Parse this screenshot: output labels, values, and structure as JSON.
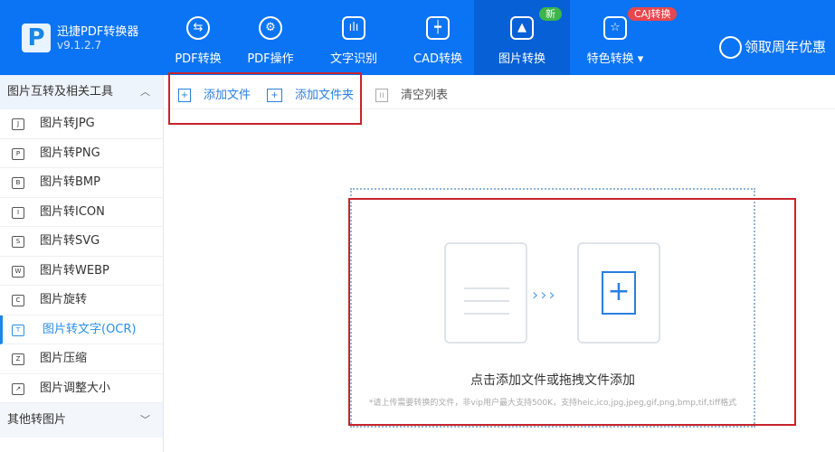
{
  "app": {
    "name": "迅捷PDF转换器",
    "version": "v9.1.2.7"
  },
  "nav": [
    {
      "label": "PDF转换",
      "icon": "⇆"
    },
    {
      "label": "PDF操作",
      "icon": "⚙"
    },
    {
      "label": "文字识别",
      "icon": "ılı"
    },
    {
      "label": "CAD转换",
      "icon": "┿"
    },
    {
      "label": "图片转换",
      "icon": "▲"
    },
    {
      "label": "特色转换 ▾",
      "icon": "☆"
    }
  ],
  "badges": {
    "new": "新",
    "caj": "CAJ转换"
  },
  "promo": "领取周年优惠",
  "sidebar": {
    "section1": "图片互转及相关工具",
    "section2": "其他转图片",
    "items": [
      {
        "label": "图片转JPG",
        "ic": "J"
      },
      {
        "label": "图片转PNG",
        "ic": "P"
      },
      {
        "label": "图片转BMP",
        "ic": "B"
      },
      {
        "label": "图片转ICON",
        "ic": "I"
      },
      {
        "label": "图片转SVG",
        "ic": "S"
      },
      {
        "label": "图片转WEBP",
        "ic": "W"
      },
      {
        "label": "图片旋转",
        "ic": "C"
      },
      {
        "label": "图片转文字(OCR)",
        "ic": "T"
      },
      {
        "label": "图片压缩",
        "ic": "Z"
      },
      {
        "label": "图片调整大小",
        "ic": "↗"
      }
    ]
  },
  "toolbar": {
    "add_file": "添加文件",
    "add_folder": "添加文件夹",
    "clear": "清空列表"
  },
  "drop": {
    "title": "点击添加文件或拖拽文件添加",
    "hint": "*请上传需要转换的文件，非vip用户最大支持500K，支持heic,ico,jpg,jpeg,gif,png,bmp,tif,tiff格式",
    "arrows": "›››",
    "plus": "+"
  },
  "colors": {
    "brand": "#0b74f4",
    "accent": "#2a8ee8",
    "highlight": "#c8232c"
  }
}
